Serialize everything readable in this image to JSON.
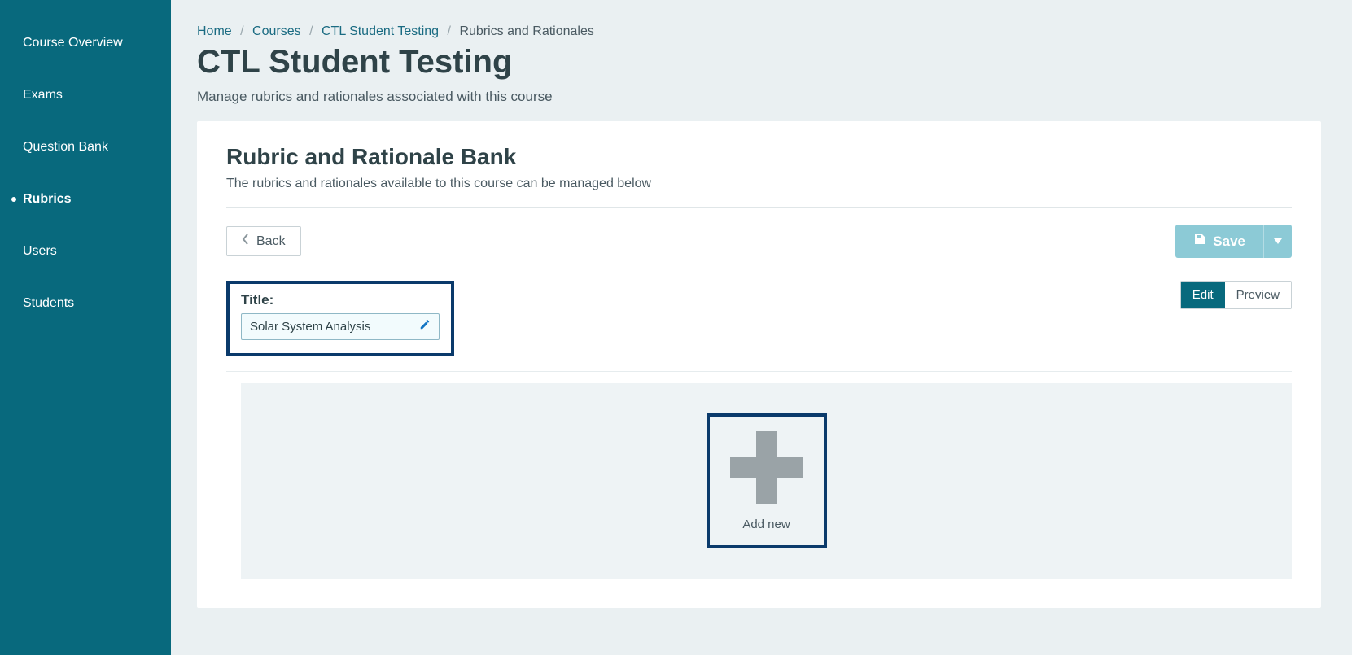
{
  "sidebar": {
    "items": [
      {
        "label": "Course Overview",
        "active": false
      },
      {
        "label": "Exams",
        "active": false
      },
      {
        "label": "Question Bank",
        "active": false
      },
      {
        "label": "Rubrics",
        "active": true
      },
      {
        "label": "Users",
        "active": false
      },
      {
        "label": "Students",
        "active": false
      }
    ]
  },
  "breadcrumb": {
    "home": "Home",
    "courses": "Courses",
    "course": "CTL Student Testing",
    "current": "Rubrics and Rationales"
  },
  "page": {
    "title": "CTL Student Testing",
    "subtitle": "Manage rubrics and rationales associated with this course"
  },
  "card": {
    "title": "Rubric and Rationale Bank",
    "subtitle": "The rubrics and rationales available to this course can be managed below"
  },
  "toolbar": {
    "back_label": "Back",
    "save_label": "Save"
  },
  "title_field": {
    "label": "Title:",
    "value": "Solar System Analysis"
  },
  "mode": {
    "edit": "Edit",
    "preview": "Preview"
  },
  "add_new": {
    "label": "Add new"
  }
}
